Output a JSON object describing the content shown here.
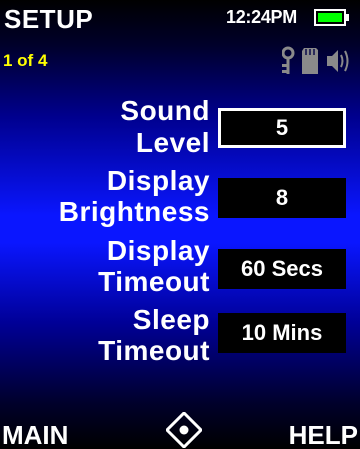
{
  "header": {
    "title": "SETUP",
    "page_indicator": "1 of 4",
    "time": "12:24PM"
  },
  "status_icons": [
    "key-icon",
    "sd-card-icon",
    "speaker-icon"
  ],
  "battery": {
    "level": 1.0
  },
  "settings": [
    {
      "label_line1": "Sound",
      "label_line2": "Level",
      "value": "5",
      "selected": true
    },
    {
      "label_line1": "Display",
      "label_line2": "Brightness",
      "value": "8",
      "selected": false
    },
    {
      "label_line1": "Display",
      "label_line2": "Timeout",
      "value": "60 Secs",
      "selected": false
    },
    {
      "label_line1": "Sleep",
      "label_line2": "Timeout",
      "value": "10 Mins",
      "selected": false
    }
  ],
  "softkeys": {
    "left": "MAIN",
    "right": "HELP",
    "center_icon": "navigation-pad-icon"
  },
  "colors": {
    "accent_yellow": "#ffff00",
    "battery_green": "#00ff00",
    "background_blue": "#0a16ff"
  }
}
